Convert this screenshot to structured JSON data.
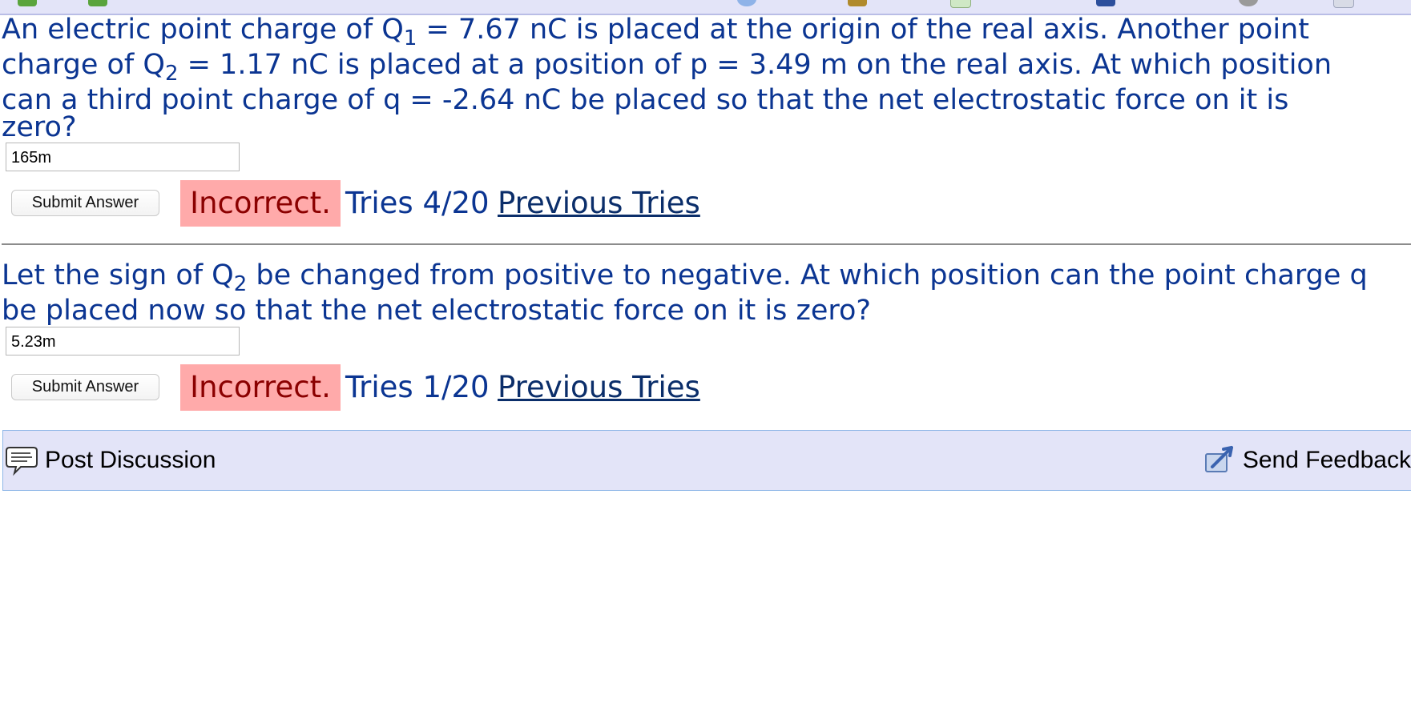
{
  "problem1": {
    "line1_a": "An electric point charge of Q",
    "line1_sub": "1",
    "line1_b": " = 7.67 nC is placed at the origin of the real axis. Another point",
    "line2_a": "charge of Q",
    "line2_sub": "2",
    "line2_b": " = 1.17 nC is placed at a position of p = 3.49 m on the real axis. At which position",
    "line3": "can a third point charge of q = -2.64 nC be placed so that the net electrostatic force on it is",
    "line4": "zero?",
    "answer_value": "165m",
    "submit_label": "Submit Answer",
    "status": "Incorrect.",
    "tries": "Tries 4/20",
    "previous_tries": "Previous Tries"
  },
  "problem2": {
    "line1_a": "Let the sign of Q",
    "line1_sub": "2",
    "line1_b": " be changed from positive to negative. At which position can the point charge q",
    "line2": "be placed now so that the net electrostatic force on it is zero?",
    "answer_value": "5.23m",
    "submit_label": "Submit Answer",
    "status": "Incorrect.",
    "tries": "Tries 1/20",
    "previous_tries": "Previous Tries"
  },
  "footer": {
    "post_discussion": "Post Discussion",
    "send_feedback": "Send Feedback"
  },
  "colors": {
    "question_text": "#0b3592",
    "incorrect_bg": "#ffaaaa",
    "incorrect_text": "#8b0000",
    "footer_bg": "#e3e4f8"
  }
}
